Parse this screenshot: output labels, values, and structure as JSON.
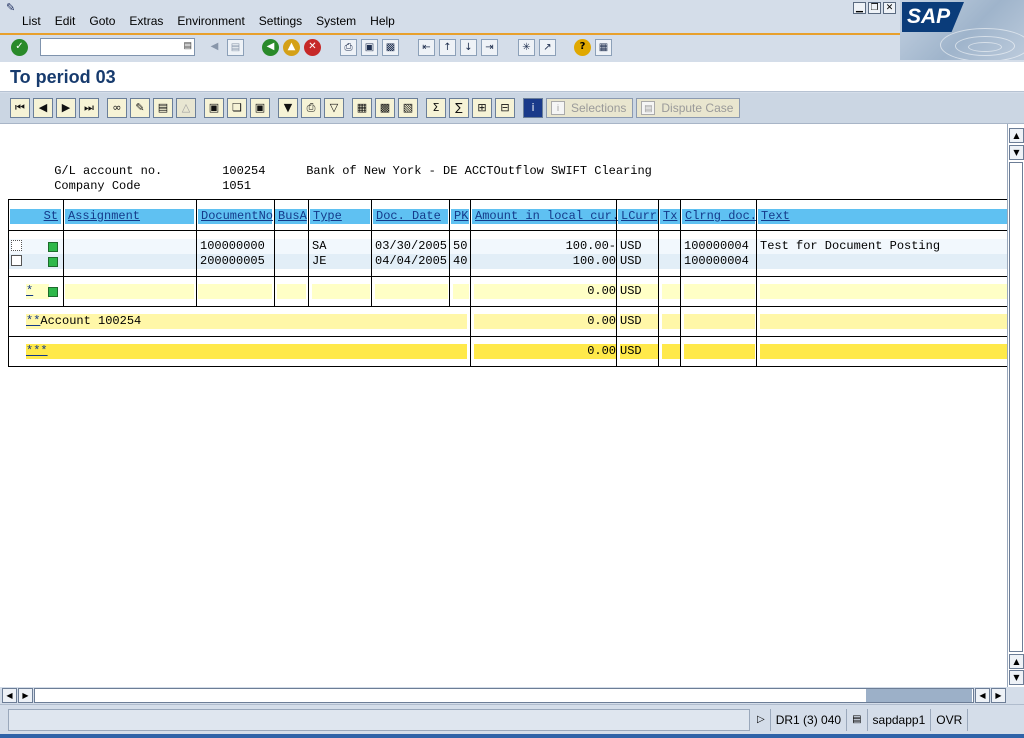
{
  "menu": {
    "items": [
      "List",
      "Edit",
      "Goto",
      "Extras",
      "Environment",
      "Settings",
      "System",
      "Help"
    ]
  },
  "sap_logo": "SAP",
  "page_title": "To period 03",
  "app_toolbar": {
    "selections_label": "Selections",
    "dispute_case_label": "Dispute Case"
  },
  "header_info": {
    "gl_account_label": "G/L account no.",
    "gl_account_value": "100254",
    "gl_account_desc": "Bank of New York - DE ACCTOutflow SWIFT Clearing",
    "company_code_label": "Company Code",
    "company_code_value": "1051"
  },
  "table": {
    "headers": [
      "St",
      "Assignment",
      "DocumentNo",
      "BusA",
      "Type",
      "Doc. Date",
      "PK",
      "Amount in local cur.",
      "LCurr",
      "Tx",
      "Clrng doc.",
      "Text"
    ],
    "rows": [
      {
        "assignment": "",
        "document_no": "100000000",
        "busa": "",
        "type": "SA",
        "doc_date": "03/30/2005",
        "pk": "50",
        "amount": "100.00-",
        "lcurr": "USD",
        "tx": "",
        "clrng_doc": "100000004",
        "text": "Test for Document Posting"
      },
      {
        "assignment": "",
        "document_no": "200000005",
        "busa": "",
        "type": "JE",
        "doc_date": "04/04/2005",
        "pk": "40",
        "amount": "100.00",
        "lcurr": "USD",
        "tx": "",
        "clrng_doc": "100000004",
        "text": ""
      }
    ],
    "subtotal": {
      "marker": "*",
      "amount": "0.00",
      "lcurr": "USD"
    },
    "account_total": {
      "marker": "**",
      "label": "Account 100254",
      "amount": "0.00",
      "lcurr": "USD"
    },
    "grand_total": {
      "marker": "***",
      "amount": "0.00",
      "lcurr": "USD"
    }
  },
  "status_bar": {
    "system": "DR1 (3) 040",
    "server": "sapdapp1",
    "mode": "OVR"
  }
}
